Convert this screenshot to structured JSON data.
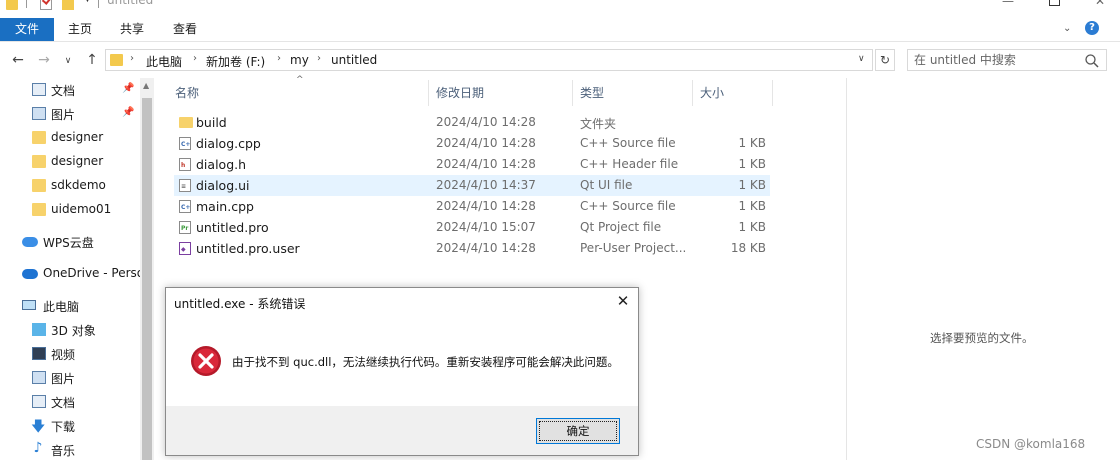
{
  "window": {
    "title": "untitled",
    "colors": {
      "accent": "#1a6fc2",
      "selected_row": "#e5f3ff",
      "error_red": "#c5162b"
    }
  },
  "ribbon": {
    "tabs": [
      "文件",
      "主页",
      "共享",
      "查看"
    ],
    "help": "?"
  },
  "address": {
    "crumbs": [
      "此电脑",
      "新加卷 (F:)",
      "my",
      "untitled"
    ]
  },
  "search": {
    "placeholder": "在 untitled 中搜索"
  },
  "sidebar": {
    "items": [
      {
        "label": "文档",
        "icon": "document-icon",
        "pinned": true
      },
      {
        "label": "图片",
        "icon": "pictures-icon",
        "pinned": true
      },
      {
        "label": "designer",
        "icon": "folder-icon"
      },
      {
        "label": "designer",
        "icon": "folder-icon"
      },
      {
        "label": "sdkdemo",
        "icon": "folder-icon"
      },
      {
        "label": "uidemo01",
        "icon": "folder-icon"
      },
      {
        "label": "WPS云盘",
        "icon": "wps-cloud-icon"
      },
      {
        "label": "OneDrive - Perso",
        "icon": "onedrive-icon"
      },
      {
        "label": "此电脑",
        "icon": "computer-icon"
      },
      {
        "label": "3D 对象",
        "icon": "3d-objects-icon"
      },
      {
        "label": "视频",
        "icon": "videos-icon"
      },
      {
        "label": "图片",
        "icon": "pictures-icon"
      },
      {
        "label": "文档",
        "icon": "document-icon"
      },
      {
        "label": "下载",
        "icon": "download-icon"
      },
      {
        "label": "音乐",
        "icon": "music-icon"
      }
    ]
  },
  "filelist": {
    "columns": {
      "name": "名称",
      "date": "修改日期",
      "type": "类型",
      "size": "大小"
    },
    "rows": [
      {
        "name": "build",
        "date": "2024/4/10 14:28",
        "type": "文件夹",
        "size": "",
        "icon": "folder-icon"
      },
      {
        "name": "dialog.cpp",
        "date": "2024/4/10 14:28",
        "type": "C++ Source file",
        "size": "1 KB",
        "icon": "cpp-file-icon"
      },
      {
        "name": "dialog.h",
        "date": "2024/4/10 14:28",
        "type": "C++ Header file",
        "size": "1 KB",
        "icon": "header-file-icon"
      },
      {
        "name": "dialog.ui",
        "date": "2024/4/10 14:37",
        "type": "Qt UI file",
        "size": "1 KB",
        "icon": "ui-file-icon"
      },
      {
        "name": "main.cpp",
        "date": "2024/4/10 14:28",
        "type": "C++ Source file",
        "size": "1 KB",
        "icon": "cpp-file-icon"
      },
      {
        "name": "untitled.pro",
        "date": "2024/4/10 15:07",
        "type": "Qt Project file",
        "size": "1 KB",
        "icon": "pro-file-icon"
      },
      {
        "name": "untitled.pro.user",
        "date": "2024/4/10 14:28",
        "type": "Per-User Project...",
        "size": "18 KB",
        "icon": "user-file-icon"
      }
    ]
  },
  "preview": {
    "text": "选择要预览的文件。"
  },
  "watermark": "CSDN @komla168",
  "dialog": {
    "title": "untitled.exe - 系统错误",
    "message": "由于找不到 quc.dll，无法继续执行代码。重新安装程序可能会解决此问题。",
    "ok_label": "确定",
    "close": "✕"
  }
}
